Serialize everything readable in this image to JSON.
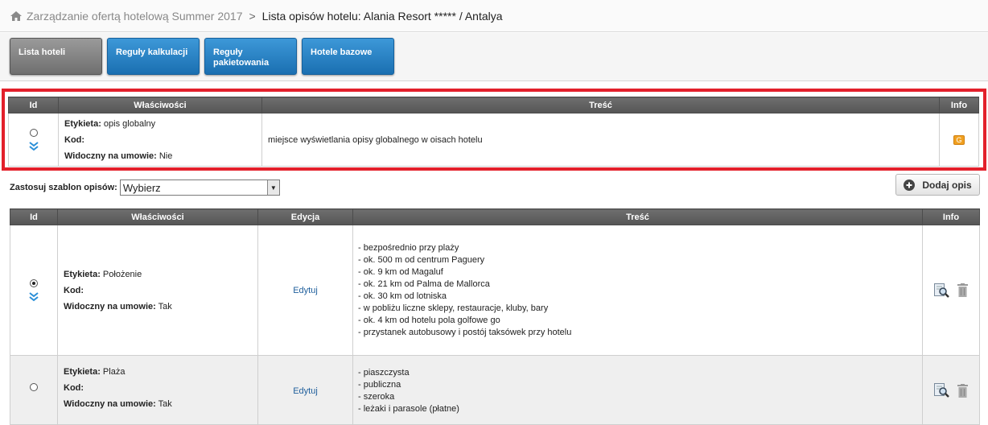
{
  "breadcrumb": {
    "home_link": "Zarządzanie ofertą hotelową Summer 2017",
    "separator": ">",
    "current": "Lista opisów hotelu: Alania Resort ***** / Antalya"
  },
  "tabs": [
    {
      "label": "Lista hoteli",
      "active": true
    },
    {
      "label": "Reguły kalkulacji",
      "active": false
    },
    {
      "label": "Reguły pakietowania",
      "active": false
    },
    {
      "label": "Hotele bazowe",
      "active": false
    }
  ],
  "global_table": {
    "headers": {
      "id": "Id",
      "props": "Właściwości",
      "content": "Treść",
      "info": "Info"
    },
    "row": {
      "label_key": "Etykieta:",
      "label_value": "opis globalny",
      "code_key": "Kod:",
      "code_value": "",
      "visible_key": "Widoczny na umowie:",
      "visible_value": "Nie",
      "content": "miejsce wyświetlania opisy globalnego w oisach hotelu",
      "badge": "G"
    }
  },
  "template": {
    "label": "Zastosuj szablon opisów:",
    "selected": "Wybierz"
  },
  "add_button": {
    "label": "Dodaj opis"
  },
  "main_table": {
    "headers": {
      "id": "Id",
      "props": "Właściwości",
      "edit": "Edycja",
      "content": "Treść",
      "info": "Info"
    },
    "rows": [
      {
        "selected": true,
        "label_key": "Etykieta:",
        "label_value": "Położenie",
        "code_key": "Kod:",
        "code_value": "",
        "visible_key": "Widoczny na umowie:",
        "visible_value": "Tak",
        "edit": "Edytuj",
        "lines": [
          "- bezpośrednio przy plaży",
          "- ok. 500 m od centrum Paguery",
          "- ok. 9 km od Magaluf",
          "- ok. 21 km od Palma de Mallorca",
          "- ok. 30 km od lotniska",
          "- w pobliżu liczne sklepy, restauracje, kluby, bary",
          "- ok. 4 km od hotelu pola golfowe go",
          "- przystanek autobusowy i postój taksówek przy hotelu"
        ]
      },
      {
        "selected": false,
        "label_key": "Etykieta:",
        "label_value": "Plaża",
        "code_key": "Kod:",
        "code_value": "",
        "visible_key": "Widoczny na umowie:",
        "visible_value": "Tak",
        "edit": "Edytuj",
        "lines": [
          "- piaszczysta",
          "- publiczna",
          "- szeroka",
          "- leżaki i parasole (płatne)"
        ]
      }
    ]
  },
  "colors": {
    "highlight": "#e3202b",
    "tab_blue": "#2580c3",
    "tab_active": "#7d7d7d",
    "header_bg": "#5e5e5e",
    "link": "#1f5f9c",
    "badge": "#f0a020"
  }
}
